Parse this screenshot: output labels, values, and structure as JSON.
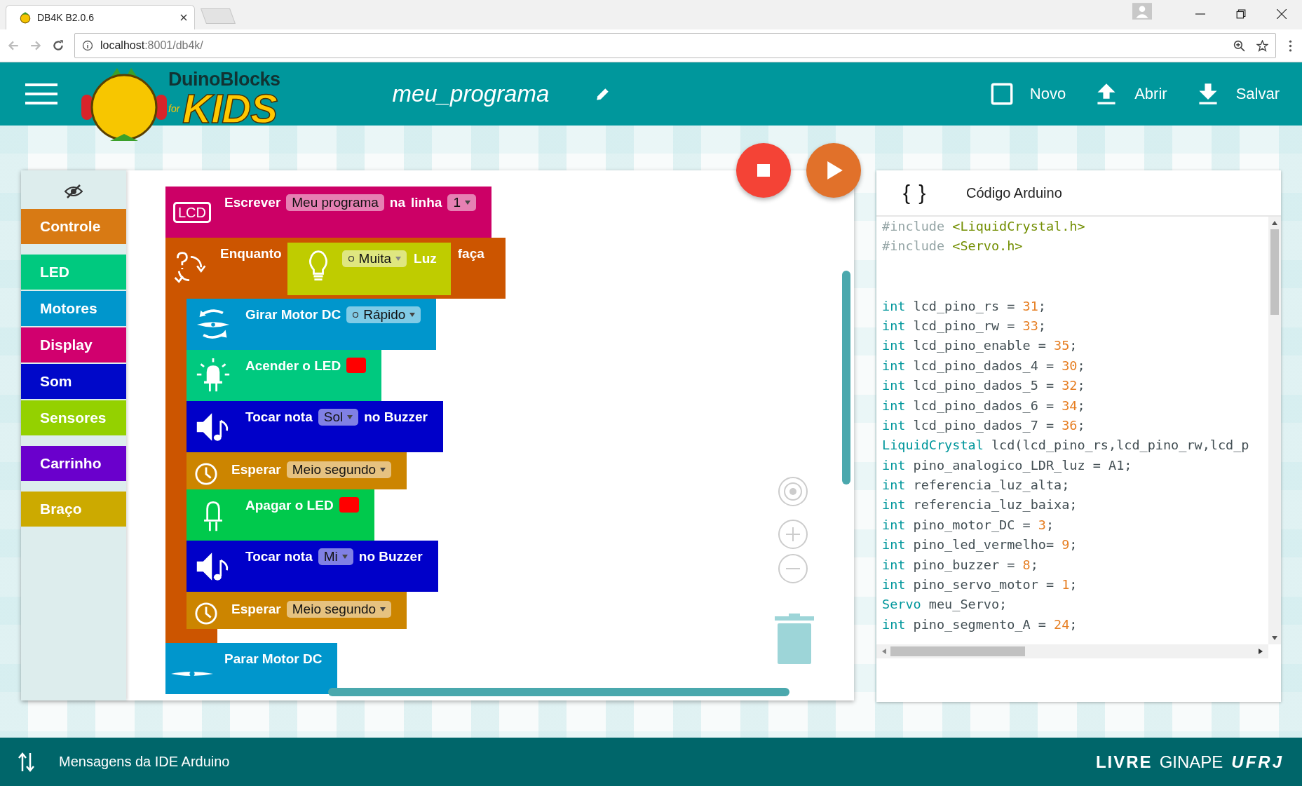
{
  "browser": {
    "tab_title": "DB4K B2.0.6",
    "url_host": "localhost",
    "url_path": ":8001/db4k/"
  },
  "header": {
    "brand_top": "DuinoBlocks",
    "brand_for": "for",
    "brand_main": "KIDS",
    "program_name": "meu_programa",
    "actions": [
      {
        "kind": "new",
        "label": "Novo"
      },
      {
        "kind": "open",
        "label": "Abrir"
      },
      {
        "kind": "save",
        "label": "Salvar"
      }
    ]
  },
  "category_groups": [
    [
      {
        "label": "Controle",
        "color": "#d87a14"
      }
    ],
    [
      {
        "label": "LED",
        "color": "#00c97f"
      },
      {
        "label": "Motores",
        "color": "#0096cc"
      },
      {
        "label": "Display",
        "color": "#d1006e"
      },
      {
        "label": "Som",
        "color": "#0008c9"
      },
      {
        "label": "Sensores",
        "color": "#94d100"
      }
    ],
    [
      {
        "label": "Carrinho",
        "color": "#6a00cc"
      }
    ],
    [
      {
        "label": "Braço",
        "color": "#ccaa00"
      }
    ]
  ],
  "blocks": [
    {
      "kind": "lcd_write",
      "color": "#cc0066",
      "icon_label": "LCD",
      "parts": [
        {
          "kind": "text",
          "text": "Escrever"
        },
        {
          "kind": "field",
          "text": "Meu programa"
        },
        {
          "kind": "text",
          "text": "na"
        },
        {
          "kind": "text",
          "text": "linha"
        },
        {
          "kind": "dropdown",
          "text": "1"
        }
      ]
    },
    {
      "kind": "while",
      "color": "#cc5500",
      "parts": [
        {
          "kind": "text",
          "text": "Enquanto"
        }
      ],
      "condition": {
        "kind": "light_sensor",
        "color": "#bfcc00",
        "parts": [
          {
            "kind": "radio_dropdown",
            "text": "Muita"
          },
          {
            "kind": "text",
            "text": "Luz"
          }
        ]
      },
      "tail": [
        {
          "kind": "text",
          "text": "faça"
        }
      ],
      "children": [
        {
          "kind": "motor_spin",
          "color": "#0096cc",
          "parts": [
            {
              "kind": "text",
              "text": "Girar Motor DC"
            },
            {
              "kind": "radio_dropdown",
              "text": "Rápido"
            }
          ]
        },
        {
          "kind": "led_on",
          "color": "#00c97f",
          "parts": [
            {
              "kind": "text",
              "text": "Acender o LED"
            },
            {
              "kind": "color",
              "color": "#ff0000"
            }
          ]
        },
        {
          "kind": "play_note",
          "color": "#0000c9",
          "parts": [
            {
              "kind": "text",
              "text": "Tocar nota"
            },
            {
              "kind": "dropdown",
              "text": "Sol"
            },
            {
              "kind": "text",
              "text": "no Buzzer"
            }
          ]
        },
        {
          "kind": "wait",
          "color": "#cc8500",
          "parts": [
            {
              "kind": "text",
              "text": "Esperar"
            },
            {
              "kind": "dropdown",
              "text": "Meio segundo"
            }
          ]
        },
        {
          "kind": "led_off",
          "color": "#00c94c",
          "parts": [
            {
              "kind": "text",
              "text": "Apagar o LED"
            },
            {
              "kind": "color",
              "color": "#ff0000"
            }
          ]
        },
        {
          "kind": "play_note",
          "color": "#0000c9",
          "parts": [
            {
              "kind": "text",
              "text": "Tocar nota"
            },
            {
              "kind": "dropdown",
              "text": "Mi"
            },
            {
              "kind": "text",
              "text": "no Buzzer"
            }
          ]
        },
        {
          "kind": "wait",
          "color": "#cc8500",
          "parts": [
            {
              "kind": "text",
              "text": "Esperar"
            },
            {
              "kind": "dropdown",
              "text": "Meio segundo"
            }
          ]
        }
      ]
    },
    {
      "kind": "motor_stop",
      "color": "#0096cc",
      "parts": [
        {
          "kind": "text",
          "text": "Parar Motor DC"
        }
      ]
    }
  ],
  "code_panel": {
    "icon_text": "{ }",
    "title": "Código Arduino",
    "lines": [
      {
        "kind": "code",
        "tokens": [
          {
            "kind": "pre",
            "text": "#include "
          },
          {
            "kind": "lib",
            "text": "<LiquidCrystal.h>"
          }
        ]
      },
      {
        "kind": "code",
        "tokens": [
          {
            "kind": "pre",
            "text": "#include "
          },
          {
            "kind": "lib",
            "text": "<Servo.h>"
          }
        ]
      },
      {
        "kind": "blank"
      },
      {
        "kind": "blank"
      },
      {
        "kind": "code",
        "tokens": [
          {
            "kind": "type",
            "text": "int"
          },
          {
            "kind": "plain",
            "text": " lcd_pino_rs = "
          },
          {
            "kind": "num",
            "text": "31"
          },
          {
            "kind": "plain",
            "text": ";"
          }
        ]
      },
      {
        "kind": "code",
        "tokens": [
          {
            "kind": "type",
            "text": "int"
          },
          {
            "kind": "plain",
            "text": " lcd_pino_rw = "
          },
          {
            "kind": "num",
            "text": "33"
          },
          {
            "kind": "plain",
            "text": ";"
          }
        ]
      },
      {
        "kind": "code",
        "tokens": [
          {
            "kind": "type",
            "text": "int"
          },
          {
            "kind": "plain",
            "text": " lcd_pino_enable = "
          },
          {
            "kind": "num",
            "text": "35"
          },
          {
            "kind": "plain",
            "text": ";"
          }
        ]
      },
      {
        "kind": "code",
        "tokens": [
          {
            "kind": "type",
            "text": "int"
          },
          {
            "kind": "plain",
            "text": " lcd_pino_dados_4 = "
          },
          {
            "kind": "num",
            "text": "30"
          },
          {
            "kind": "plain",
            "text": ";"
          }
        ]
      },
      {
        "kind": "code",
        "tokens": [
          {
            "kind": "type",
            "text": "int"
          },
          {
            "kind": "plain",
            "text": " lcd_pino_dados_5 = "
          },
          {
            "kind": "num",
            "text": "32"
          },
          {
            "kind": "plain",
            "text": ";"
          }
        ]
      },
      {
        "kind": "code",
        "tokens": [
          {
            "kind": "type",
            "text": "int"
          },
          {
            "kind": "plain",
            "text": " lcd_pino_dados_6 = "
          },
          {
            "kind": "num",
            "text": "34"
          },
          {
            "kind": "plain",
            "text": ";"
          }
        ]
      },
      {
        "kind": "code",
        "tokens": [
          {
            "kind": "type",
            "text": "int"
          },
          {
            "kind": "plain",
            "text": " lcd_pino_dados_7 = "
          },
          {
            "kind": "num",
            "text": "36"
          },
          {
            "kind": "plain",
            "text": ";"
          }
        ]
      },
      {
        "kind": "code",
        "tokens": [
          {
            "kind": "type",
            "text": "LiquidCrystal"
          },
          {
            "kind": "plain",
            "text": " lcd(lcd_pino_rs,lcd_pino_rw,lcd_p"
          }
        ]
      },
      {
        "kind": "code",
        "tokens": [
          {
            "kind": "type",
            "text": "int"
          },
          {
            "kind": "plain",
            "text": " pino_analogico_LDR_luz = A1;"
          }
        ]
      },
      {
        "kind": "code",
        "tokens": [
          {
            "kind": "type",
            "text": "int"
          },
          {
            "kind": "plain",
            "text": " referencia_luz_alta;"
          }
        ]
      },
      {
        "kind": "code",
        "tokens": [
          {
            "kind": "type",
            "text": "int"
          },
          {
            "kind": "plain",
            "text": " referencia_luz_baixa;"
          }
        ]
      },
      {
        "kind": "code",
        "tokens": [
          {
            "kind": "type",
            "text": "int"
          },
          {
            "kind": "plain",
            "text": " pino_motor_DC = "
          },
          {
            "kind": "num",
            "text": "3"
          },
          {
            "kind": "plain",
            "text": ";"
          }
        ]
      },
      {
        "kind": "code",
        "tokens": [
          {
            "kind": "type",
            "text": "int"
          },
          {
            "kind": "plain",
            "text": " pino_led_vermelho= "
          },
          {
            "kind": "num",
            "text": "9"
          },
          {
            "kind": "plain",
            "text": ";"
          }
        ]
      },
      {
        "kind": "code",
        "tokens": [
          {
            "kind": "type",
            "text": "int"
          },
          {
            "kind": "plain",
            "text": " pino_buzzer = "
          },
          {
            "kind": "num",
            "text": "8"
          },
          {
            "kind": "plain",
            "text": ";"
          }
        ]
      },
      {
        "kind": "code",
        "tokens": [
          {
            "kind": "type",
            "text": "int"
          },
          {
            "kind": "plain",
            "text": " pino_servo_motor = "
          },
          {
            "kind": "num",
            "text": "1"
          },
          {
            "kind": "plain",
            "text": ";"
          }
        ]
      },
      {
        "kind": "code",
        "tokens": [
          {
            "kind": "type",
            "text": "Servo"
          },
          {
            "kind": "plain",
            "text": " meu_Servo;"
          }
        ]
      },
      {
        "kind": "code",
        "tokens": [
          {
            "kind": "type",
            "text": "int"
          },
          {
            "kind": "plain",
            "text": " pino_segmento_A = "
          },
          {
            "kind": "num",
            "text": "24"
          },
          {
            "kind": "plain",
            "text": ";"
          }
        ]
      }
    ]
  },
  "footer": {
    "messages_label": "Mensagens da IDE Arduino",
    "partners": [
      "LIVRE",
      "GINAPE",
      "UFRJ"
    ]
  }
}
